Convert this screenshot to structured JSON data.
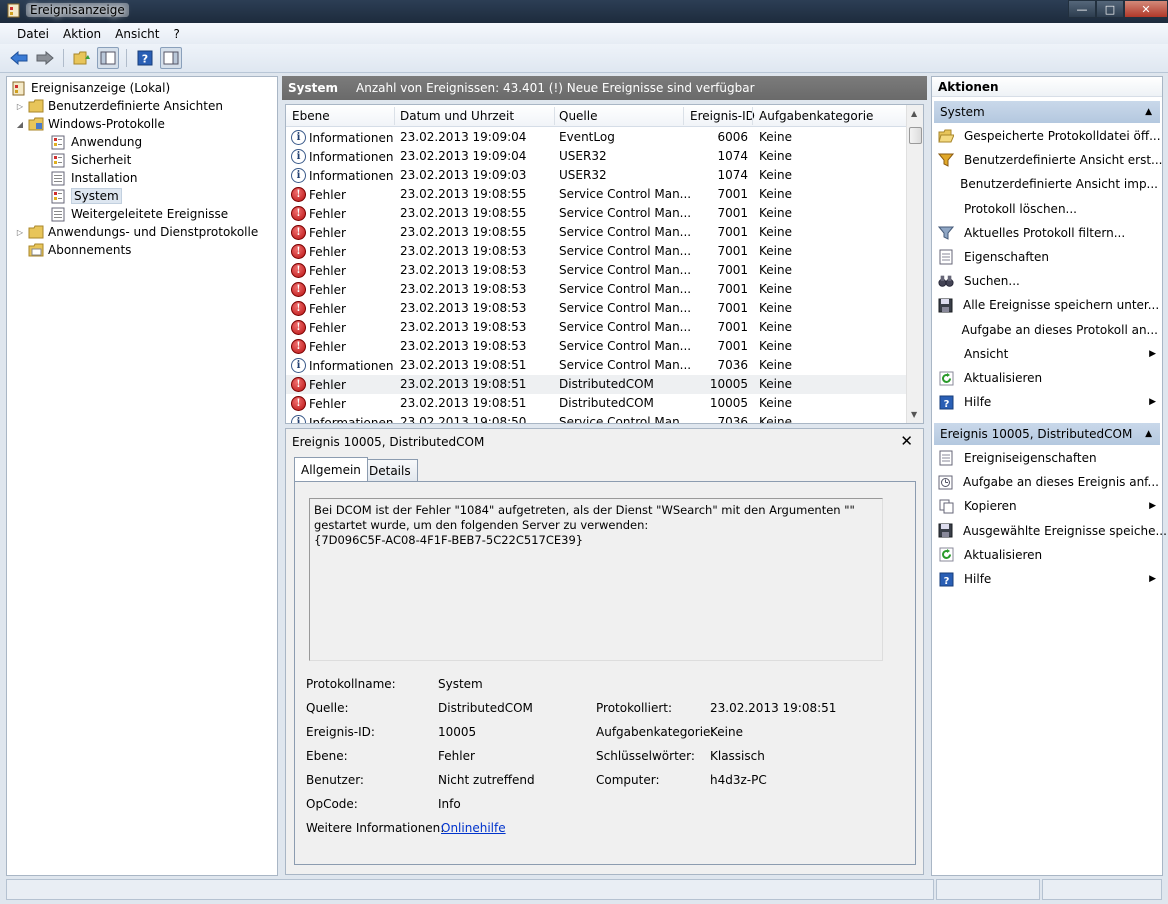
{
  "window": {
    "title": "Ereignisanzeige"
  },
  "menu": [
    "Datei",
    "Aktion",
    "Ansicht",
    "?"
  ],
  "tree": {
    "root": "Ereignisanzeige (Lokal)",
    "custom_views": "Benutzerdefinierte Ansichten",
    "windows_logs": "Windows-Protokolle",
    "logs": [
      "Anwendung",
      "Sicherheit",
      "Installation",
      "System",
      "Weitergeleitete Ereignisse"
    ],
    "app_service_logs": "Anwendungs- und Dienstprotokolle",
    "subscriptions": "Abonnements"
  },
  "middle": {
    "log_name": "System",
    "event_count": "Anzahl von Ereignissen: 43.401 (!) Neue Ereignisse sind verfügbar"
  },
  "event_columns": [
    "Ebene",
    "Datum und Uhrzeit",
    "Quelle",
    "Ereignis-ID",
    "Aufgabenkategorie"
  ],
  "events": [
    {
      "level": "Informationen",
      "type": "info",
      "date": "23.02.2013 19:09:04",
      "source": "EventLog",
      "id": "6006",
      "category": "Keine"
    },
    {
      "level": "Informationen",
      "type": "info",
      "date": "23.02.2013 19:09:04",
      "source": "USER32",
      "id": "1074",
      "category": "Keine"
    },
    {
      "level": "Informationen",
      "type": "info",
      "date": "23.02.2013 19:09:03",
      "source": "USER32",
      "id": "1074",
      "category": "Keine"
    },
    {
      "level": "Fehler",
      "type": "err",
      "date": "23.02.2013 19:08:55",
      "source": "Service Control Man...",
      "id": "7001",
      "category": "Keine"
    },
    {
      "level": "Fehler",
      "type": "err",
      "date": "23.02.2013 19:08:55",
      "source": "Service Control Man...",
      "id": "7001",
      "category": "Keine"
    },
    {
      "level": "Fehler",
      "type": "err",
      "date": "23.02.2013 19:08:55",
      "source": "Service Control Man...",
      "id": "7001",
      "category": "Keine"
    },
    {
      "level": "Fehler",
      "type": "err",
      "date": "23.02.2013 19:08:53",
      "source": "Service Control Man...",
      "id": "7001",
      "category": "Keine"
    },
    {
      "level": "Fehler",
      "type": "err",
      "date": "23.02.2013 19:08:53",
      "source": "Service Control Man...",
      "id": "7001",
      "category": "Keine"
    },
    {
      "level": "Fehler",
      "type": "err",
      "date": "23.02.2013 19:08:53",
      "source": "Service Control Man...",
      "id": "7001",
      "category": "Keine"
    },
    {
      "level": "Fehler",
      "type": "err",
      "date": "23.02.2013 19:08:53",
      "source": "Service Control Man...",
      "id": "7001",
      "category": "Keine"
    },
    {
      "level": "Fehler",
      "type": "err",
      "date": "23.02.2013 19:08:53",
      "source": "Service Control Man...",
      "id": "7001",
      "category": "Keine"
    },
    {
      "level": "Fehler",
      "type": "err",
      "date": "23.02.2013 19:08:53",
      "source": "Service Control Man...",
      "id": "7001",
      "category": "Keine"
    },
    {
      "level": "Informationen",
      "type": "info",
      "date": "23.02.2013 19:08:51",
      "source": "Service Control Man...",
      "id": "7036",
      "category": "Keine"
    },
    {
      "level": "Fehler",
      "type": "err",
      "date": "23.02.2013 19:08:51",
      "source": "DistributedCOM",
      "id": "10005",
      "category": "Keine",
      "selected": true
    },
    {
      "level": "Fehler",
      "type": "err",
      "date": "23.02.2013 19:08:51",
      "source": "DistributedCOM",
      "id": "10005",
      "category": "Keine"
    },
    {
      "level": "Informationen",
      "type": "info",
      "date": "23.02.2013 19:08:50",
      "source": "Service Control Man...",
      "id": "7036",
      "category": "Keine"
    }
  ],
  "detail": {
    "title": "Ereignis 10005, DistributedCOM",
    "tabs": [
      "Allgemein",
      "Details"
    ],
    "description": "Bei DCOM ist der Fehler \"1084\" aufgetreten, als der Dienst \"WSearch\" mit den Argumenten \"\" gestartet wurde, um den folgenden Server zu verwenden:\n{7D096C5F-AC08-4F1F-BEB7-5C22C517CE39}",
    "labels": {
      "log_name": "Protokollname:",
      "source": "Quelle:",
      "event_id": "Ereignis-ID:",
      "level": "Ebene:",
      "user": "Benutzer:",
      "opcode": "OpCode:",
      "more_info": "Weitere Informationen:",
      "logged": "Protokolliert:",
      "task_category": "Aufgabenkategorie:",
      "keywords": "Schlüsselwörter:",
      "computer": "Computer:"
    },
    "values": {
      "log_name": "System",
      "source": "DistributedCOM",
      "event_id": "10005",
      "level": "Fehler",
      "user": "Nicht zutreffend",
      "opcode": "Info",
      "more_info": "Onlinehilfe",
      "logged": "23.02.2013 19:08:51",
      "task_category": "Keine",
      "keywords": "Klassisch",
      "computer": "h4d3z-PC"
    }
  },
  "actions": {
    "header": "Aktionen",
    "section1": "System",
    "section1_items": [
      {
        "label": "Gespeicherte Protokolldatei öff...",
        "icon": "folder-open-icon"
      },
      {
        "label": "Benutzerdefinierte Ansicht erst...",
        "icon": "filter-icon"
      },
      {
        "label": "Benutzerdefinierte Ansicht imp...",
        "icon": ""
      },
      {
        "label": "Protokoll löschen...",
        "icon": ""
      },
      {
        "label": "Aktuelles Protokoll filtern...",
        "icon": "funnel-icon"
      },
      {
        "label": "Eigenschaften",
        "icon": "properties-icon"
      },
      {
        "label": "Suchen...",
        "icon": "binoculars-icon"
      },
      {
        "label": "Alle Ereignisse speichern unter...",
        "icon": "save-icon"
      },
      {
        "label": "Aufgabe an dieses Protokoll an...",
        "icon": ""
      },
      {
        "label": "Ansicht",
        "icon": "",
        "submenu": true
      },
      {
        "label": "Aktualisieren",
        "icon": "refresh-icon"
      },
      {
        "label": "Hilfe",
        "icon": "help-icon",
        "submenu": true
      }
    ],
    "section2": "Ereignis 10005, DistributedCOM",
    "section2_items": [
      {
        "label": "Ereigniseigenschaften",
        "icon": "properties-icon"
      },
      {
        "label": "Aufgabe an dieses Ereignis anf...",
        "icon": "task-icon"
      },
      {
        "label": "Kopieren",
        "icon": "copy-icon",
        "submenu": true
      },
      {
        "label": "Ausgewählte Ereignisse speiche...",
        "icon": "save-icon"
      },
      {
        "label": "Aktualisieren",
        "icon": "refresh-icon"
      },
      {
        "label": "Hilfe",
        "icon": "help-icon",
        "submenu": true
      }
    ]
  }
}
